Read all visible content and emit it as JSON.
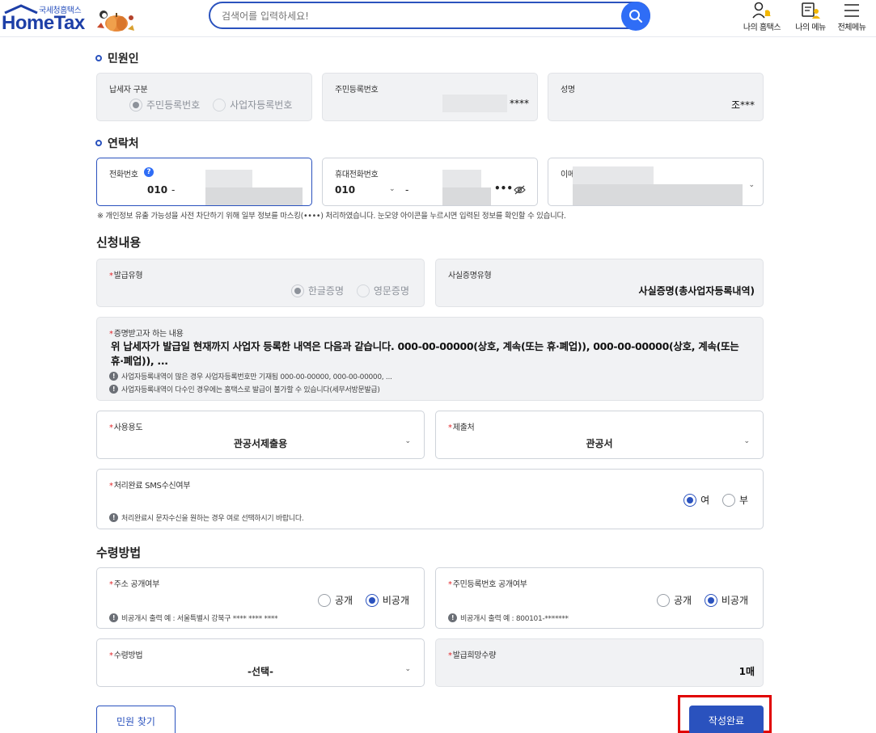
{
  "header": {
    "logo_sub": "국세청홈택스",
    "logo_main": "HomeTax",
    "search_placeholder": "검색어를 입력하세요!",
    "nav": [
      {
        "label": "나의 홈택스",
        "icon": "user-bell-icon"
      },
      {
        "label": "나의 메뉴",
        "icon": "menu-user-icon"
      },
      {
        "label": "전체메뉴",
        "icon": "hamburger-icon"
      }
    ]
  },
  "applicant": {
    "title": "민원인",
    "taxpayer_type_label": "납세자 구분",
    "taxpayer_options": [
      "주민등록번호",
      "사업자등록번호"
    ],
    "taxpayer_selected": 0,
    "rrn_label": "주민등록번호",
    "rrn_value": "****",
    "name_label": "성명",
    "name_value": "조***"
  },
  "contact": {
    "title": "연락처",
    "phone_label": "전화번호",
    "phone_prefix": "010",
    "phone_sep": "-",
    "mobile_label": "휴대전화번호",
    "mobile_prefix": "010",
    "mobile_sep": "-",
    "mobile_masked": "•••",
    "email_label": "이메",
    "note": "※ 개인정보 유출 가능성을 사전 차단하기 위해 일부 정보를 마스킹(••••) 처리하였습니다. 눈모양 아이콘을 누르시면 입력된 정보를 확인할 수 있습니다."
  },
  "request": {
    "title": "신청내용",
    "issue_type_label": "발급유형",
    "issue_options": [
      "한글증명",
      "영문증명"
    ],
    "issue_selected": 0,
    "cert_type_label": "사실증명유형",
    "cert_type_value": "사실증명(총사업자등록내역)",
    "content_label": "증명받고자 하는 내용",
    "content_text": "위 납세자가 발급일 현재까지 사업자 등록한 내역은 다음과 같습니다. 000-00-00000(상호, 계속(또는 휴·폐업)), 000-00-00000(상호, 계속(또는 휴·폐업)), ...",
    "content_info": [
      "사업자등록내역이 많은 경우 사업자등록번호만 기재됨 000-00-00000, 000-00-00000, ...",
      "사업자등록내역이 다수인 경우에는 홈택스로 발급이 불가할 수 있습니다(세무서방문발급)"
    ],
    "usage_label": "사용용도",
    "usage_value": "관공서제출용",
    "submit_to_label": "제출처",
    "submit_to_value": "관공서",
    "sms_label": "처리완료 SMS수신여부",
    "sms_options": [
      "여",
      "부"
    ],
    "sms_selected": 0,
    "sms_info": "처리완료시 문자수신을 원하는 경우 여로 선택하시기 바랍니다."
  },
  "receipt": {
    "title": "수령방법",
    "address_label": "주소 공개여부",
    "address_options": [
      "공개",
      "비공개"
    ],
    "address_selected": 1,
    "address_info": "비공개시 출력 예 : 서울특별시 강북구 **** **** ****",
    "rrn_pub_label": "주민등록번호 공개여부",
    "rrn_pub_options": [
      "공개",
      "비공개"
    ],
    "rrn_pub_selected": 1,
    "rrn_pub_info": "비공개시 출력 예 : 800101-*******",
    "method_label": "수령방법",
    "method_value": "-선택-",
    "count_label": "발급희망수량",
    "count_value": "1매"
  },
  "buttons": {
    "find": "민원 찾기",
    "complete": "작성완료"
  },
  "colors": {
    "primary": "#2a52be",
    "required": "#e3262a",
    "highlight": "#e00000"
  }
}
